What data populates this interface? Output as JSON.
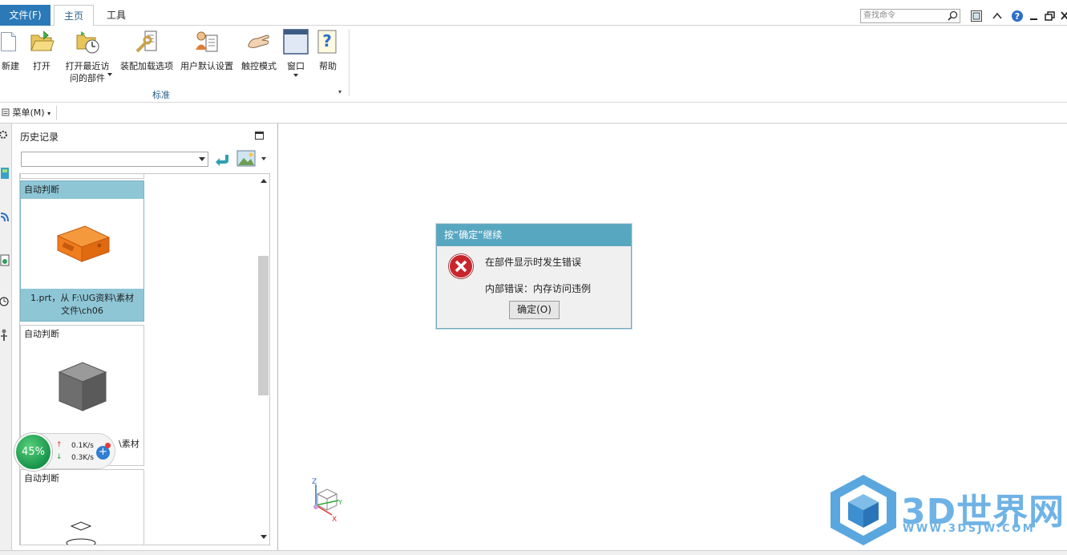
{
  "tabs": {
    "file": "文件(F)",
    "home": "主页",
    "tools": "工具"
  },
  "search": {
    "placeholder": "查找命令"
  },
  "ribbon": {
    "buttons": [
      {
        "label": "新建",
        "icon": "new-file-icon"
      },
      {
        "label": "打开",
        "icon": "open-folder-icon"
      },
      {
        "label_line1": "打开最近访",
        "label_line2": "问的部件",
        "icon": "recent-parts-icon"
      },
      {
        "label": "装配加载选项",
        "icon": "assembly-load-options-icon"
      },
      {
        "label": "用户默认设置",
        "icon": "user-defaults-icon"
      },
      {
        "label": "触控模式",
        "icon": "touch-mode-icon"
      },
      {
        "label": "窗口",
        "icon": "window-icon"
      },
      {
        "label": "帮助",
        "icon": "help-icon"
      }
    ],
    "group_label": "标准"
  },
  "menu": {
    "label": "菜单(M)"
  },
  "nav": {
    "title": "历史记录",
    "cards": [
      {
        "head": "自动判断",
        "foot_line1": "1.prt，从 F:\\UG资料\\素材",
        "foot_line2": "文件\\ch06"
      },
      {
        "head": "自动判断",
        "foot_partial": "\\素材"
      },
      {
        "head": "自动判断"
      }
    ]
  },
  "dialog": {
    "title": "按“确定”继续",
    "message": "在部件显示时发生错误",
    "detail": "内部错误：内存访问违例",
    "ok": "确定(O)"
  },
  "speed_widget": {
    "percent": "45%",
    "upload": "0.1K/s",
    "download": "0.3K/s"
  },
  "triad": {
    "z": "Z",
    "y": "Y",
    "x": "X"
  },
  "watermark": {
    "brand": "3D世界网",
    "url": "WWW.3DSJW.COM"
  },
  "colors": {
    "accent": "#2b79b7",
    "dialog_title": "#58a7c1",
    "selected_card": "#8ec6d6",
    "part_orange": "#f07d1e"
  }
}
